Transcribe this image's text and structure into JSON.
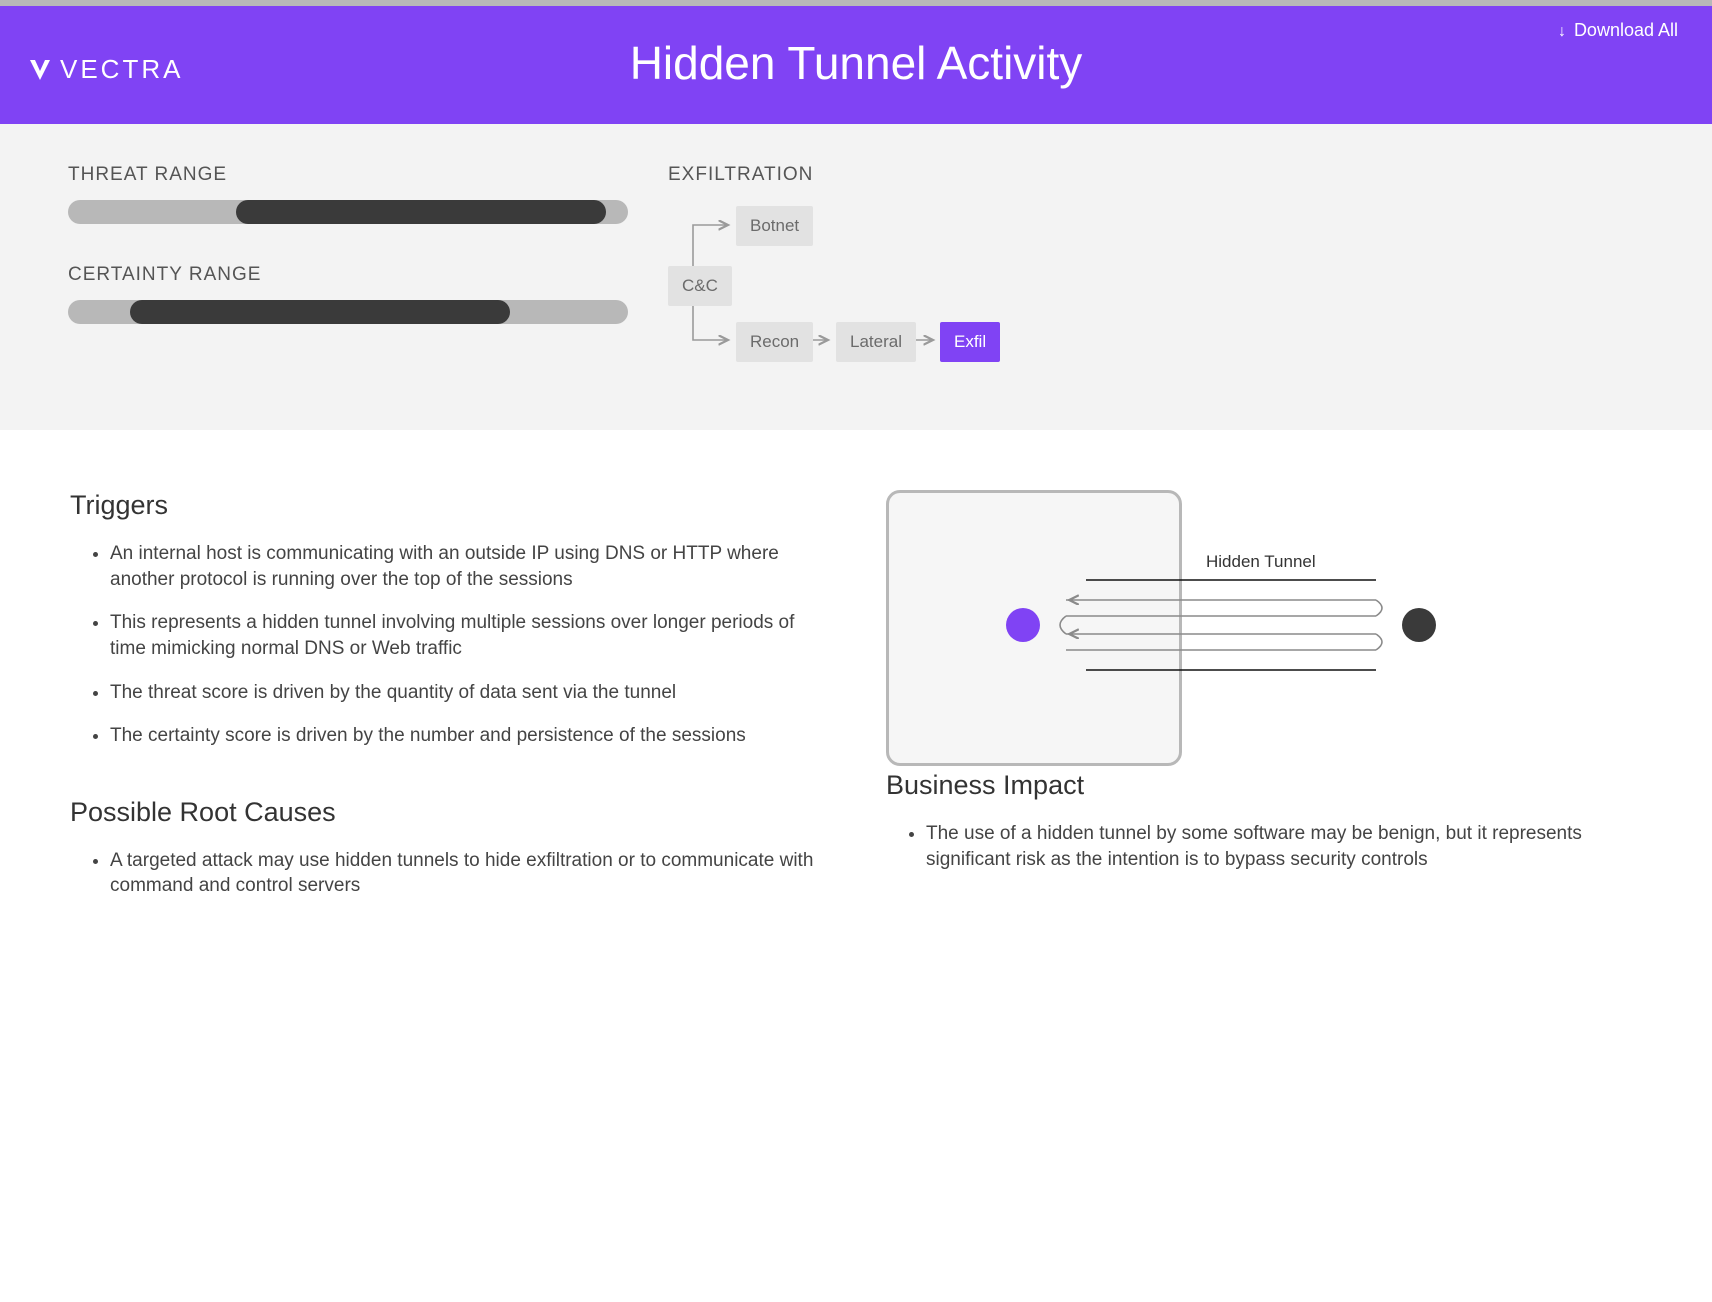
{
  "brand": "VECTRA",
  "page_title": "Hidden Tunnel Activity",
  "download_label": "Download All",
  "ranges": {
    "threat": {
      "label": "THREAT RANGE",
      "start_pct": 30,
      "end_pct": 96
    },
    "certainty": {
      "label": "CERTAINTY RANGE",
      "start_pct": 11,
      "end_pct": 79
    }
  },
  "exfil": {
    "label": "EXFILTRATION",
    "nodes": {
      "cc": "C&C",
      "botnet": "Botnet",
      "recon": "Recon",
      "lateral": "Lateral",
      "exfil": "Exfil"
    }
  },
  "illus_label": "Hidden Tunnel",
  "sections": {
    "triggers": {
      "title": "Triggers",
      "items": [
        "An internal host is communicating with an outside IP using DNS or HTTP where another protocol is running over the top of the sessions",
        "This represents a hidden tunnel involving multiple sessions over longer periods of time mimicking normal DNS or Web traffic",
        "The threat score is driven by the quantity of data sent via the tunnel",
        "The certainty score is driven by the number and persistence of the sessions"
      ]
    },
    "root_causes": {
      "title": "Possible Root Causes",
      "items": [
        "A targeted attack may use hidden tunnels to hide exfiltration or to communicate with command and control servers"
      ]
    },
    "business_impact": {
      "title": "Business Impact",
      "items": [
        "The use of a hidden tunnel by some software may be benign, but it represents significant risk as the intention is to bypass security controls"
      ]
    }
  }
}
